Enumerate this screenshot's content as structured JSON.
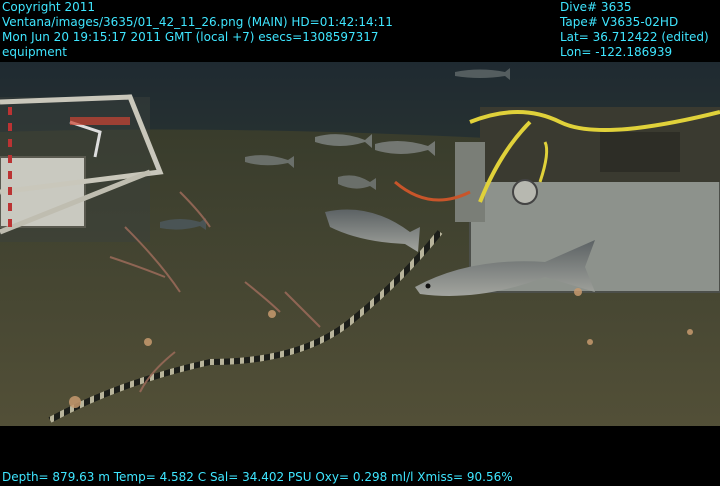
{
  "header": {
    "copyright": "Copyright 2011",
    "image_path": "Ventana/images/3635/01_42_11_26.png (MAIN)  HD=01:42:14:11",
    "datetime": "Mon Jun 20 19:15:17 2011 GMT (local +7)  esecs=1308597317",
    "category": "equipment",
    "dive": "Dive# 3635",
    "tape": "Tape# V3635-02HD",
    "lat": "Lat= 36.712422 (edited)",
    "lon": "Lon= -122.186939"
  },
  "footer": {
    "telemetry": "Depth= 879.63 m  Temp= 4.582 C  Sal= 34.402 PSU  Oxy= 0.298 ml/l  Xmiss= 90.56%"
  },
  "colors": {
    "overlay_text": "#3fe6ff",
    "seafloor": "#4a4a33",
    "water": "#27333a"
  }
}
